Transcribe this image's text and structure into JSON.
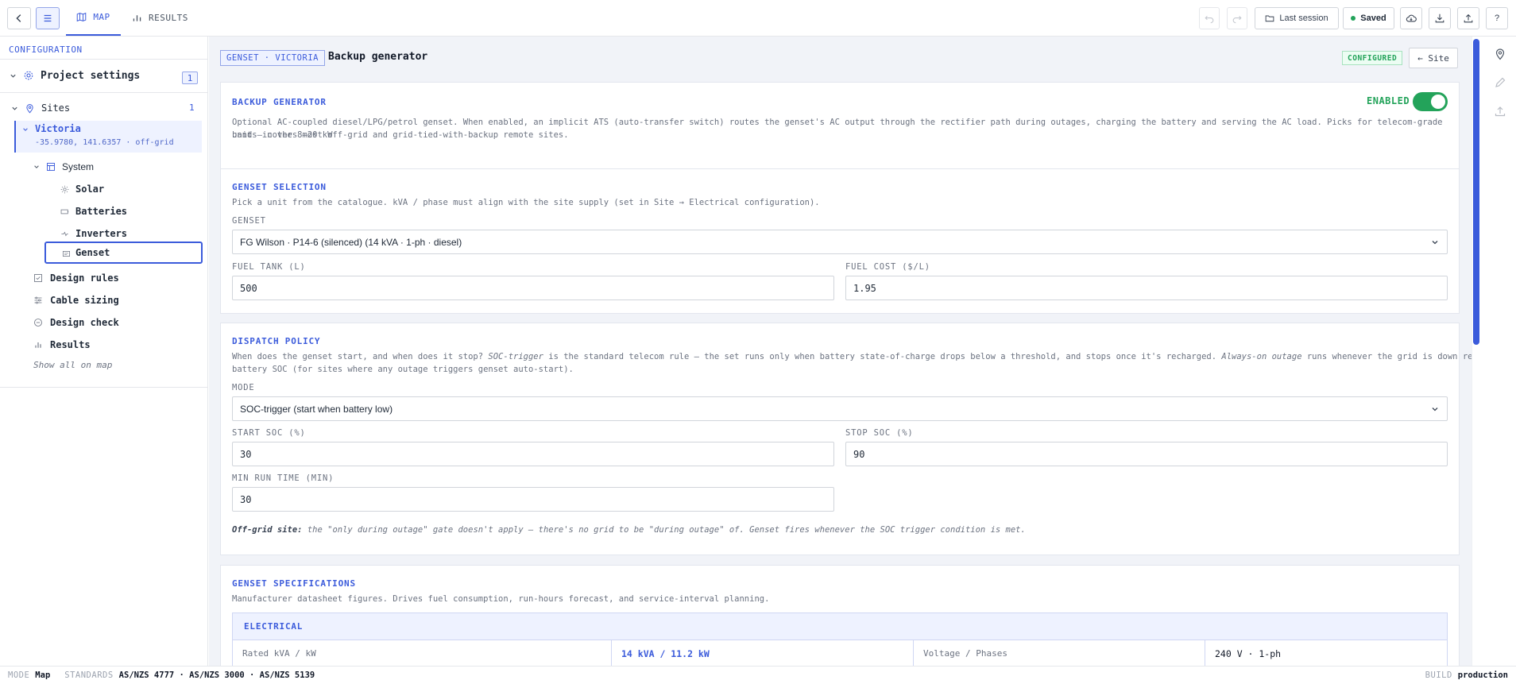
{
  "topbar": {
    "tabs": [
      {
        "label": "MAP"
      },
      {
        "label": "RESULTS"
      }
    ],
    "last_session_label": "Last session",
    "saved_label": "Saved"
  },
  "sidebar": {
    "heading": "CONFIGURATION",
    "project_settings": {
      "label": "Project settings",
      "count": "1"
    },
    "sites": {
      "label": "Sites",
      "count": "1"
    },
    "site": {
      "name": "Victoria",
      "subtitle": "-35.9780, 141.6357 · off-grid"
    },
    "system_label": "System",
    "system_items": [
      {
        "label": "Solar"
      },
      {
        "label": "Batteries"
      },
      {
        "label": "Inverters"
      },
      {
        "label": "Genset"
      }
    ],
    "site_items": [
      {
        "label": "Design rules"
      },
      {
        "label": "Cable sizing"
      },
      {
        "label": "Design check"
      },
      {
        "label": "Results"
      }
    ],
    "show_all_label": "Show all on map"
  },
  "page": {
    "breadcrumb": "GENSET · VICTORIA",
    "title": "Backup generator",
    "status_badge": "CONFIGURED",
    "site_link": "← Site"
  },
  "backup_card": {
    "title": "BACKUP GENERATOR",
    "enabled_label": "ENABLED",
    "enabled": true,
    "desc_line1": "Optional AC-coupled diesel/LPG/petrol genset. When enabled, an implicit ATS (auto-transfer switch) routes the genset's AC output through the rectifier path during outages, charging the battery and serving the AC load. Picks for telecom-grade units in the 8–20 kW",
    "desc_line2": "band — covers most off-grid and grid-tied-with-backup remote sites."
  },
  "selection_card": {
    "title": "GENSET SELECTION",
    "desc": "Pick a unit from the catalogue. kVA / phase must align with the site supply (set in Site → Electrical configuration).",
    "genset_label": "GENSET",
    "genset_value": "FG Wilson · P14-6 (silenced) (14 kVA · 1-ph · diesel)",
    "fuel_tank_label": "FUEL TANK (L)",
    "fuel_tank_value": "500",
    "fuel_cost_label": "FUEL COST ($/L)",
    "fuel_cost_value": "1.95"
  },
  "dispatch_card": {
    "title": "DISPATCH POLICY",
    "desc_a": "When does the genset start, and when does it stop? ",
    "desc_b": "SOC-trigger",
    "desc_c": " is the standard telecom rule — the set runs only when battery state-of-charge drops below a threshold, and stops once it's recharged. ",
    "desc_d": "Always-on outage",
    "desc_e": " runs whenever the grid is down regardless of",
    "desc_line2": "battery SOC (for sites where any outage triggers genset auto-start).",
    "mode_label": "MODE",
    "mode_value": "SOC-trigger (start when battery low)",
    "start_soc_label": "START SOC (%)",
    "start_soc_value": "30",
    "stop_soc_label": "STOP SOC (%)",
    "stop_soc_value": "90",
    "min_run_label": "MIN RUN TIME (MIN)",
    "min_run_value": "30",
    "note_bold": "Off-grid site:",
    "note_rest": " the \"only during outage\" gate doesn't apply — there's no grid to be \"during outage\" of. Genset fires whenever the SOC trigger condition is met."
  },
  "spec_card": {
    "title": "GENSET SPECIFICATIONS",
    "desc": "Manufacturer datasheet figures. Drives fuel consumption, run-hours forecast, and service-interval planning.",
    "section": "ELECTRICAL",
    "row": [
      {
        "label": "Rated kVA / kW",
        "value": "14 kVA / 11.2 kW"
      },
      {
        "label": "Voltage / Phases",
        "value": "240 V · 1-ph"
      }
    ]
  },
  "statusbar": {
    "mode_label": "MODE",
    "mode_value": "Map",
    "standards_label": "STANDARDS",
    "standards_value": "AS/NZS 4777 · AS/NZS 3000 · AS/NZS 5139",
    "build_label": "BUILD",
    "build_value": "production"
  },
  "colors": {
    "accent": "#3b5bdb",
    "success": "#23a35a",
    "background": "#f1f3f8"
  }
}
